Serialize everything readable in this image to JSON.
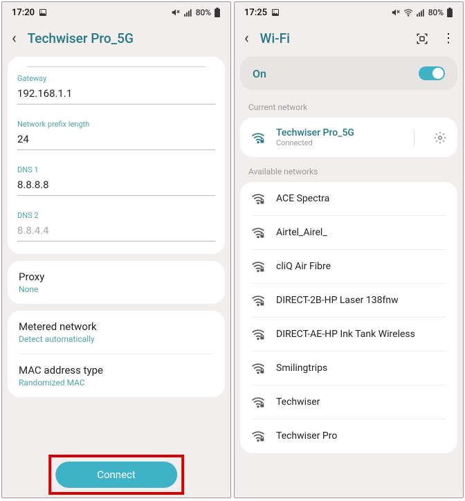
{
  "left": {
    "status": {
      "time": "17:20",
      "battery": "80%"
    },
    "header": {
      "title": "Techwiser Pro_5G"
    },
    "fields": {
      "gateway": {
        "label": "Gateway",
        "value": "192.168.1.1"
      },
      "prefix": {
        "label": "Network prefix length",
        "value": "24"
      },
      "dns1": {
        "label": "DNS 1",
        "value": "8.8.8.8"
      },
      "dns2": {
        "label": "DNS 2",
        "placeholder": "8.8.4.4"
      }
    },
    "proxy": {
      "title": "Proxy",
      "value": "None"
    },
    "metered": {
      "title": "Metered network",
      "value": "Detect automatically"
    },
    "mac": {
      "title": "MAC address type",
      "value": "Randomized MAC"
    },
    "connect": "Connect"
  },
  "right": {
    "status": {
      "time": "17:25",
      "battery": "80%"
    },
    "header": {
      "title": "Wi-Fi"
    },
    "toggle": {
      "label": "On"
    },
    "current_label": "Current network",
    "current": {
      "name": "Techwiser Pro_5G",
      "status": "Connected"
    },
    "available_label": "Available networks",
    "networks": [
      {
        "name": "ACE Spectra"
      },
      {
        "name": "Airtel_Airel_"
      },
      {
        "name": "cliQ Air Fibre"
      },
      {
        "name": "DIRECT-2B-HP Laser 138fnw"
      },
      {
        "name": "DIRECT-AE-HP Ink Tank Wireless"
      },
      {
        "name": "Smilingtrips"
      },
      {
        "name": "Techwiser"
      },
      {
        "name": "Techwiser Pro"
      }
    ]
  }
}
